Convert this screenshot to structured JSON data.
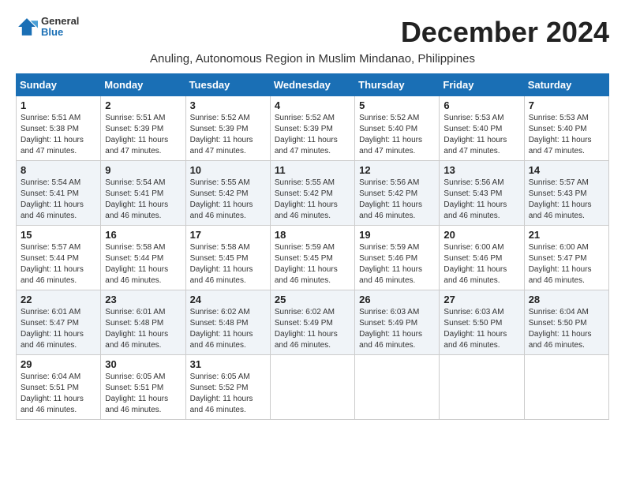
{
  "header": {
    "logo_line1": "General",
    "logo_line2": "Blue",
    "month_title": "December 2024",
    "location": "Anuling, Autonomous Region in Muslim Mindanao, Philippines"
  },
  "weekdays": [
    "Sunday",
    "Monday",
    "Tuesday",
    "Wednesday",
    "Thursday",
    "Friday",
    "Saturday"
  ],
  "weeks": [
    [
      {
        "day": "1",
        "detail": "Sunrise: 5:51 AM\nSunset: 5:38 PM\nDaylight: 11 hours\nand 47 minutes."
      },
      {
        "day": "2",
        "detail": "Sunrise: 5:51 AM\nSunset: 5:39 PM\nDaylight: 11 hours\nand 47 minutes."
      },
      {
        "day": "3",
        "detail": "Sunrise: 5:52 AM\nSunset: 5:39 PM\nDaylight: 11 hours\nand 47 minutes."
      },
      {
        "day": "4",
        "detail": "Sunrise: 5:52 AM\nSunset: 5:39 PM\nDaylight: 11 hours\nand 47 minutes."
      },
      {
        "day": "5",
        "detail": "Sunrise: 5:52 AM\nSunset: 5:40 PM\nDaylight: 11 hours\nand 47 minutes."
      },
      {
        "day": "6",
        "detail": "Sunrise: 5:53 AM\nSunset: 5:40 PM\nDaylight: 11 hours\nand 47 minutes."
      },
      {
        "day": "7",
        "detail": "Sunrise: 5:53 AM\nSunset: 5:40 PM\nDaylight: 11 hours\nand 47 minutes."
      }
    ],
    [
      {
        "day": "8",
        "detail": "Sunrise: 5:54 AM\nSunset: 5:41 PM\nDaylight: 11 hours\nand 46 minutes."
      },
      {
        "day": "9",
        "detail": "Sunrise: 5:54 AM\nSunset: 5:41 PM\nDaylight: 11 hours\nand 46 minutes."
      },
      {
        "day": "10",
        "detail": "Sunrise: 5:55 AM\nSunset: 5:42 PM\nDaylight: 11 hours\nand 46 minutes."
      },
      {
        "day": "11",
        "detail": "Sunrise: 5:55 AM\nSunset: 5:42 PM\nDaylight: 11 hours\nand 46 minutes."
      },
      {
        "day": "12",
        "detail": "Sunrise: 5:56 AM\nSunset: 5:42 PM\nDaylight: 11 hours\nand 46 minutes."
      },
      {
        "day": "13",
        "detail": "Sunrise: 5:56 AM\nSunset: 5:43 PM\nDaylight: 11 hours\nand 46 minutes."
      },
      {
        "day": "14",
        "detail": "Sunrise: 5:57 AM\nSunset: 5:43 PM\nDaylight: 11 hours\nand 46 minutes."
      }
    ],
    [
      {
        "day": "15",
        "detail": "Sunrise: 5:57 AM\nSunset: 5:44 PM\nDaylight: 11 hours\nand 46 minutes."
      },
      {
        "day": "16",
        "detail": "Sunrise: 5:58 AM\nSunset: 5:44 PM\nDaylight: 11 hours\nand 46 minutes."
      },
      {
        "day": "17",
        "detail": "Sunrise: 5:58 AM\nSunset: 5:45 PM\nDaylight: 11 hours\nand 46 minutes."
      },
      {
        "day": "18",
        "detail": "Sunrise: 5:59 AM\nSunset: 5:45 PM\nDaylight: 11 hours\nand 46 minutes."
      },
      {
        "day": "19",
        "detail": "Sunrise: 5:59 AM\nSunset: 5:46 PM\nDaylight: 11 hours\nand 46 minutes."
      },
      {
        "day": "20",
        "detail": "Sunrise: 6:00 AM\nSunset: 5:46 PM\nDaylight: 11 hours\nand 46 minutes."
      },
      {
        "day": "21",
        "detail": "Sunrise: 6:00 AM\nSunset: 5:47 PM\nDaylight: 11 hours\nand 46 minutes."
      }
    ],
    [
      {
        "day": "22",
        "detail": "Sunrise: 6:01 AM\nSunset: 5:47 PM\nDaylight: 11 hours\nand 46 minutes."
      },
      {
        "day": "23",
        "detail": "Sunrise: 6:01 AM\nSunset: 5:48 PM\nDaylight: 11 hours\nand 46 minutes."
      },
      {
        "day": "24",
        "detail": "Sunrise: 6:02 AM\nSunset: 5:48 PM\nDaylight: 11 hours\nand 46 minutes."
      },
      {
        "day": "25",
        "detail": "Sunrise: 6:02 AM\nSunset: 5:49 PM\nDaylight: 11 hours\nand 46 minutes."
      },
      {
        "day": "26",
        "detail": "Sunrise: 6:03 AM\nSunset: 5:49 PM\nDaylight: 11 hours\nand 46 minutes."
      },
      {
        "day": "27",
        "detail": "Sunrise: 6:03 AM\nSunset: 5:50 PM\nDaylight: 11 hours\nand 46 minutes."
      },
      {
        "day": "28",
        "detail": "Sunrise: 6:04 AM\nSunset: 5:50 PM\nDaylight: 11 hours\nand 46 minutes."
      }
    ],
    [
      {
        "day": "29",
        "detail": "Sunrise: 6:04 AM\nSunset: 5:51 PM\nDaylight: 11 hours\nand 46 minutes."
      },
      {
        "day": "30",
        "detail": "Sunrise: 6:05 AM\nSunset: 5:51 PM\nDaylight: 11 hours\nand 46 minutes."
      },
      {
        "day": "31",
        "detail": "Sunrise: 6:05 AM\nSunset: 5:52 PM\nDaylight: 11 hours\nand 46 minutes."
      },
      {
        "day": "",
        "detail": ""
      },
      {
        "day": "",
        "detail": ""
      },
      {
        "day": "",
        "detail": ""
      },
      {
        "day": "",
        "detail": ""
      }
    ]
  ]
}
